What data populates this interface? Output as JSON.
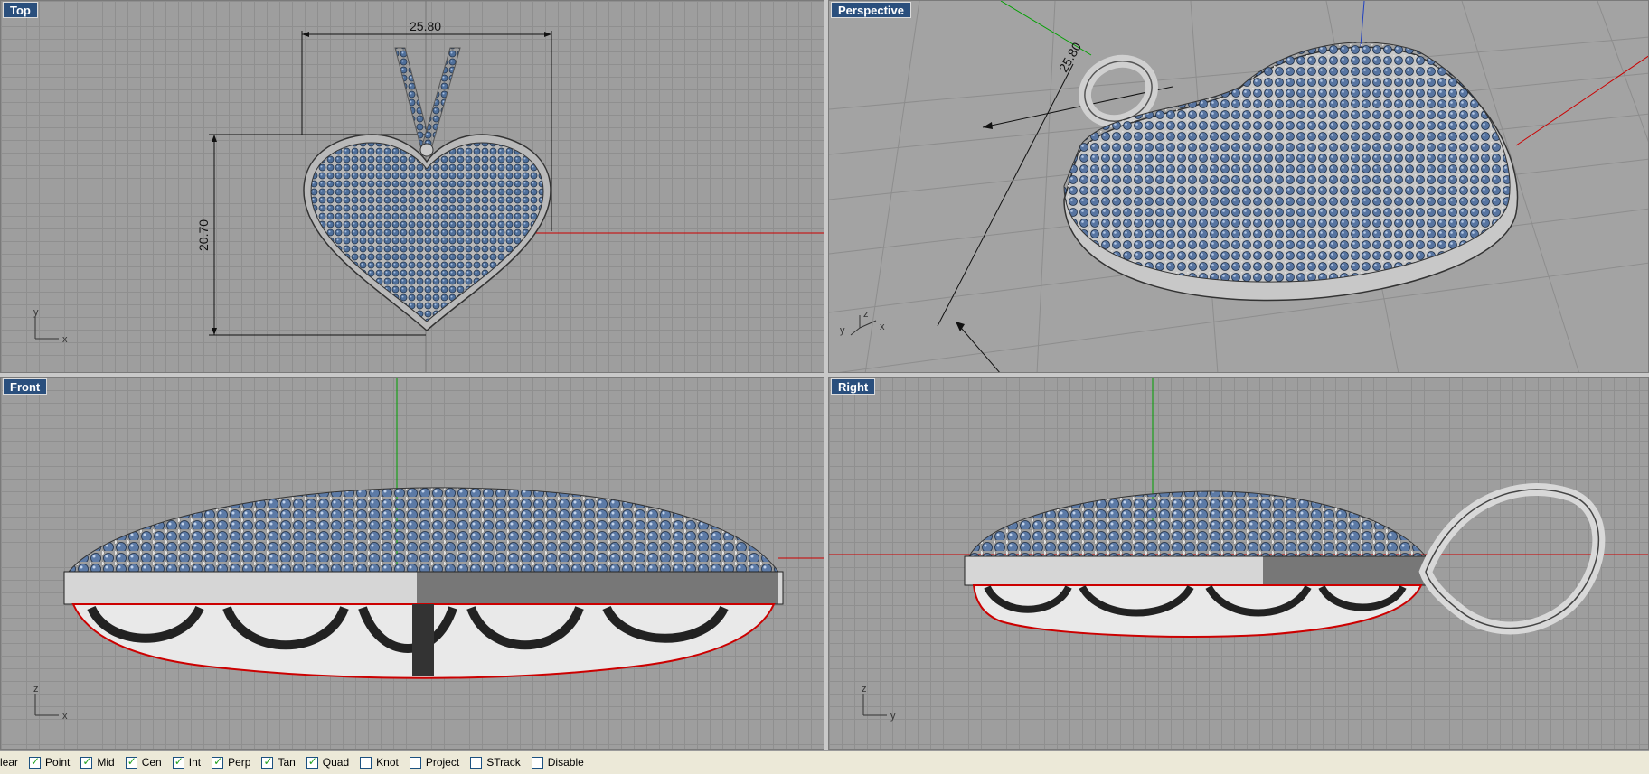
{
  "viewports": {
    "top": {
      "title": "Top",
      "dim_width": "25.80",
      "dim_height": "20.70",
      "axis_a": "y",
      "axis_b": "x"
    },
    "perspective": {
      "title": "Perspective",
      "dim_width": "25.80",
      "axis_a": "y",
      "axis_b": "z",
      "axis_c": "x"
    },
    "front": {
      "title": "Front",
      "axis_a": "z",
      "axis_b": "x"
    },
    "right": {
      "title": "Right",
      "axis_a": "z",
      "axis_b": "y"
    }
  },
  "statusbar": {
    "items": [
      {
        "label": "lear",
        "checked": null
      },
      {
        "label": "Point",
        "checked": true
      },
      {
        "label": "Mid",
        "checked": true
      },
      {
        "label": "Cen",
        "checked": true
      },
      {
        "label": "Int",
        "checked": true
      },
      {
        "label": "Perp",
        "checked": true
      },
      {
        "label": "Tan",
        "checked": true
      },
      {
        "label": "Quad",
        "checked": true
      },
      {
        "label": "Knot",
        "checked": false
      },
      {
        "label": "Project",
        "checked": false
      },
      {
        "label": "STrack",
        "checked": false
      },
      {
        "label": "Disable",
        "checked": false
      }
    ]
  },
  "colors": {
    "title_bg": "#2a4f7d",
    "gem": "#4f6f9a",
    "metal": "#cfcfcf",
    "axis_x": "#cc0000",
    "axis_y": "#00a000",
    "axis_z": "#2040c0"
  }
}
